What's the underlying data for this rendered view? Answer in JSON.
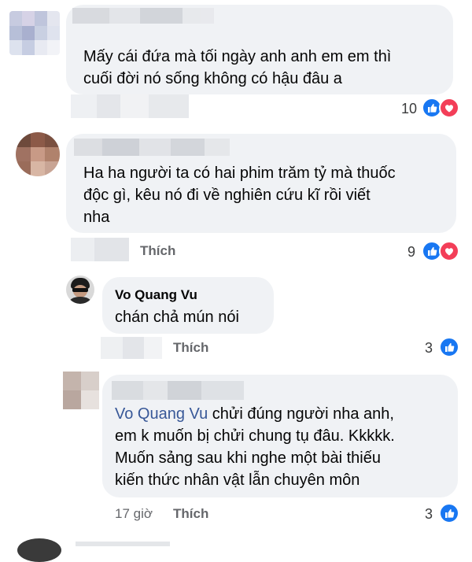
{
  "comments": [
    {
      "text_lines": [
        "Mấy cái đứa mà tối ngày anh anh em em thì",
        "cuối đời nó sống không có hậu đâu a"
      ],
      "reaction_count": "10",
      "reaction_icons": [
        "like-icon",
        "love-icon"
      ]
    },
    {
      "text_lines": [
        "Ha ha người ta có hai phim trăm tỷ mà thuốc",
        "độc gì, kêu nó đi về nghiên cứu kĩ rồi viết",
        "nha"
      ],
      "action_label": "Thích",
      "reaction_count": "9",
      "reaction_icons": [
        "like-icon",
        "love-icon"
      ]
    },
    {
      "author": "Vo Quang Vu",
      "text_lines": [
        "chán chả mún nói"
      ],
      "action_label": "Thích",
      "reaction_count": "3",
      "reaction_icons": [
        "like-icon"
      ]
    },
    {
      "mention": "Vo Quang Vu",
      "text_first_line_rest": " chửi đúng người nha anh,",
      "text_lines": [
        "em k muốn bị chửi chung tụ đâu. Kkkkk.",
        "Muốn sảng sau khi nghe một bài thiếu",
        "kiến thức nhân vật lẫn chuyên môn"
      ],
      "timestamp": "17 giờ",
      "action_label": "Thích",
      "reaction_count": "3",
      "reaction_icons": [
        "like-icon"
      ]
    }
  ],
  "colors": {
    "bubble": "#f0f2f5",
    "like": "#1877f2",
    "love": "#f33e58",
    "mention": "#385898",
    "secondary_text": "#65676b"
  }
}
